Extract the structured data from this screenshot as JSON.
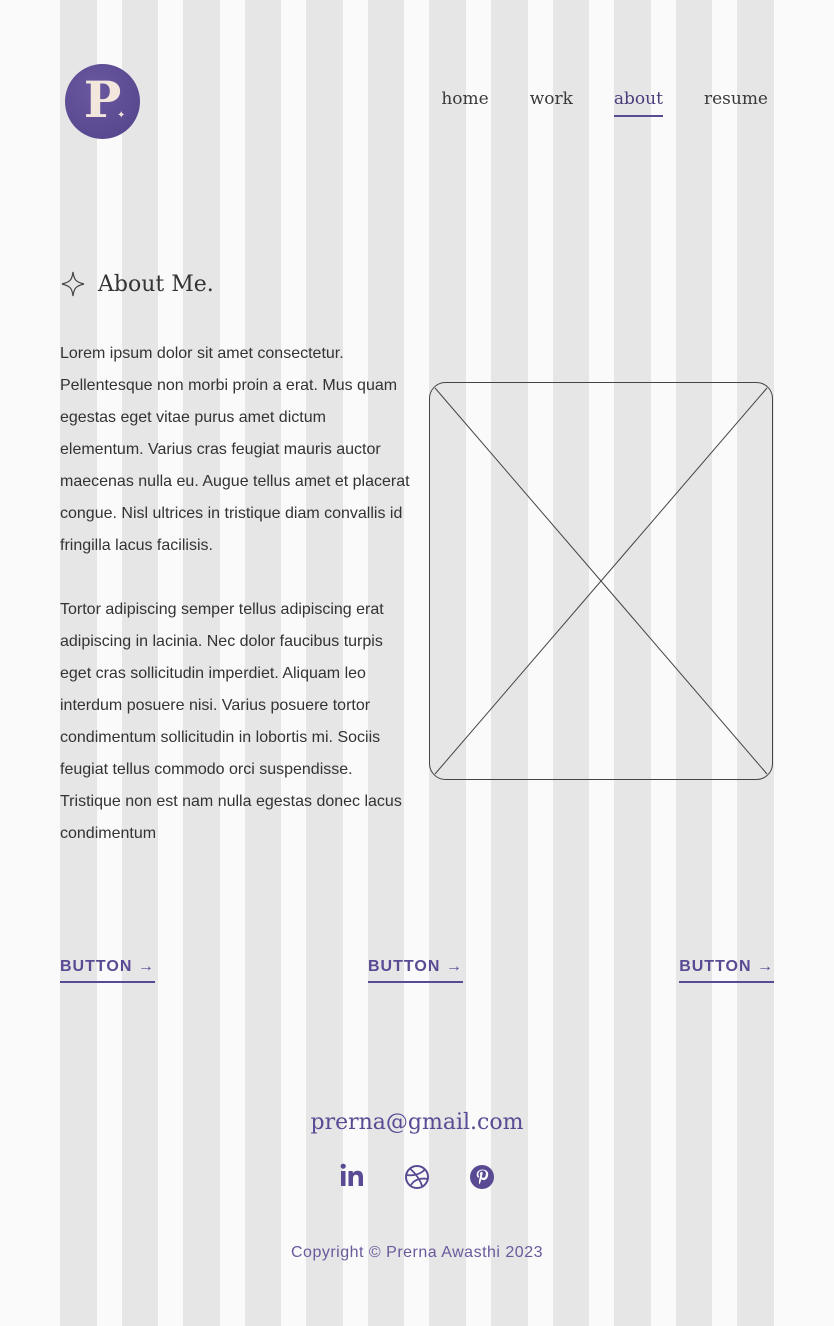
{
  "colors": {
    "accent": "#5a4a93",
    "background": "#fafafa",
    "grid_column": "#e6e6e6",
    "text": "#333333"
  },
  "logo": {
    "letter": "P",
    "star": "✦"
  },
  "nav": {
    "items": [
      {
        "label": "home",
        "active": false
      },
      {
        "label": "work",
        "active": false
      },
      {
        "label": "about",
        "active": true
      },
      {
        "label": "resume",
        "active": false
      }
    ]
  },
  "about": {
    "title": "About Me.",
    "icon": "sparkle-icon",
    "paragraphs": [
      "Lorem ipsum dolor sit amet consectetur. Pellentesque non morbi proin a erat. Mus quam egestas eget vitae purus amet dictum elementum. Varius cras feugiat mauris auctor maecenas nulla eu. Augue tellus amet et placerat congue. Nisl ultrices in tristique diam convallis id fringilla lacus facilisis.",
      "Tortor adipiscing semper tellus adipiscing erat adipiscing in lacinia. Nec dolor faucibus turpis eget cras sollicitudin imperdiet. Aliquam leo interdum posuere nisi. Varius posuere tortor condimentum sollicitudin in lobortis mi. Sociis feugiat tellus commodo orci suspendisse. Tristique non est nam nulla egestas donec lacus condimentum"
    ]
  },
  "buttons": [
    {
      "label": "BUTTON →"
    },
    {
      "label": "BUTTON →"
    },
    {
      "label": "BUTTON →"
    }
  ],
  "footer": {
    "email": "prerna@gmail.com",
    "social": [
      "linkedin-icon",
      "dribbble-icon",
      "pinterest-icon"
    ],
    "copyright": "Copyright © Prerna Awasthi 2023"
  }
}
